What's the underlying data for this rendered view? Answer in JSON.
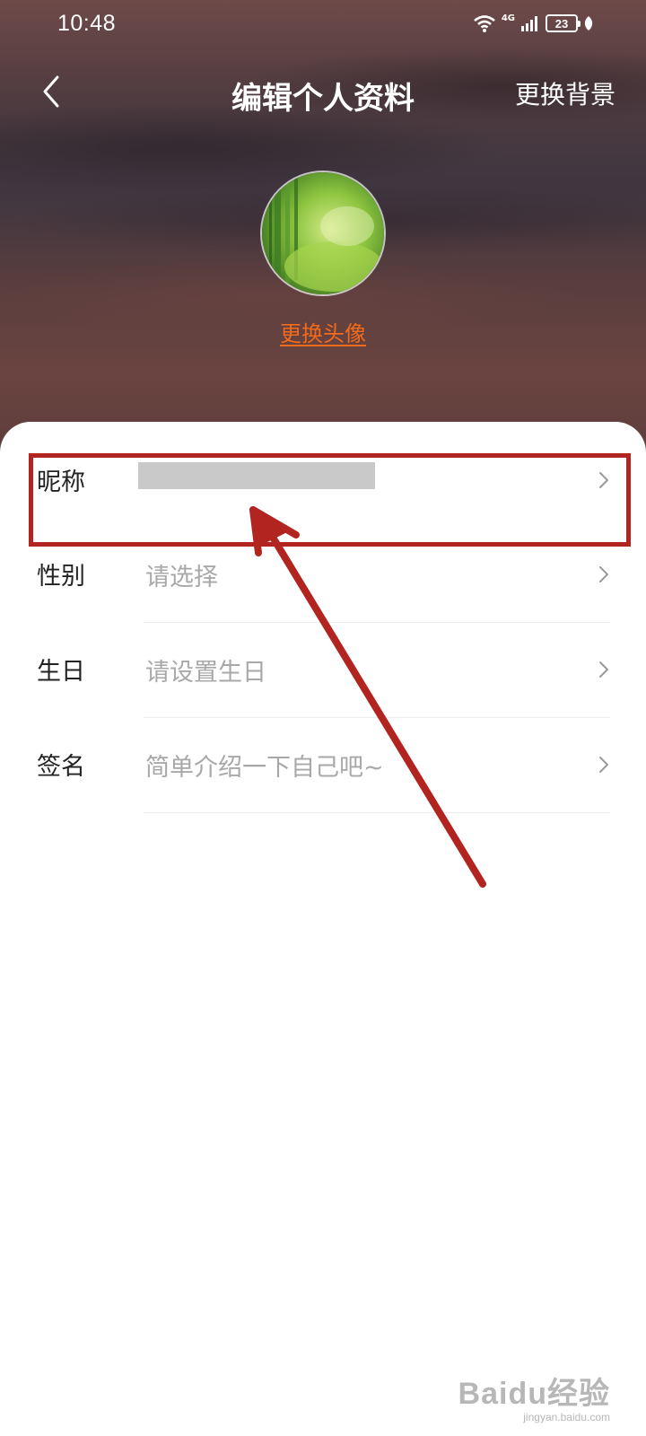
{
  "status_bar": {
    "time": "10:48",
    "network": "4G",
    "battery": "23"
  },
  "nav": {
    "title": "编辑个人资料",
    "change_background": "更换背景"
  },
  "profile": {
    "change_avatar": "更换头像"
  },
  "fields": [
    {
      "label": "昵称",
      "value": ""
    },
    {
      "label": "性别",
      "value": "请选择"
    },
    {
      "label": "生日",
      "value": "请设置生日"
    },
    {
      "label": "签名",
      "value": "简单介绍一下自己吧~"
    }
  ],
  "watermark": {
    "brand": "Baidu经验",
    "domain": "jingyan.baidu.com"
  },
  "colors": {
    "accent": "#f26a1b",
    "annotation": "#b22420"
  }
}
